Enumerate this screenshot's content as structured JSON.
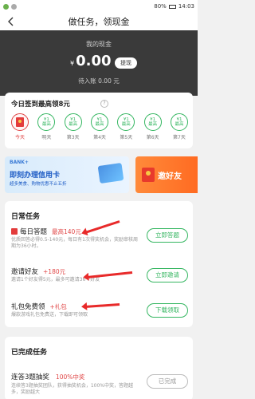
{
  "status_bar": {
    "time": "14:03",
    "battery": "80%"
  },
  "header": {
    "title": "做任务，领现金"
  },
  "money": {
    "label": "我的现金",
    "currency": "¥",
    "value": "0.00",
    "withdraw_label": "提现",
    "pending": "待入账 0.00 元"
  },
  "checkin": {
    "title": "今日签到最高领8元",
    "rules_icon": "question-icon",
    "days": [
      {
        "label": "今天",
        "amount": ""
      },
      {
        "label": "明天",
        "amount": "¥1"
      },
      {
        "label": "第3天",
        "amount": "¥1"
      },
      {
        "label": "第4天",
        "amount": "¥1"
      },
      {
        "label": "第5天",
        "amount": "¥1"
      },
      {
        "label": "第6天",
        "amount": "¥1"
      },
      {
        "label": "第7天",
        "amount": "¥1"
      }
    ],
    "coin_unit": "最高"
  },
  "banners": {
    "bank": {
      "brand": "BANK+",
      "line1": "即刻办理信用卡",
      "line2": "超多美食、购物优惠不止五折"
    },
    "invite": {
      "text": "邀好友"
    }
  },
  "daily": {
    "title": "日常任务",
    "tasks": [
      {
        "name": "每日答题",
        "reward": "最高140元",
        "desc": "优质回答必得0.5-140元，每日有1次得奖机会，奖励审核周期为36小时。",
        "button": "立即答题"
      },
      {
        "name": "邀请好友",
        "reward": "+180元",
        "desc": "邀请1个好友得5元，最多可邀请36个好友",
        "button": "立即邀请"
      },
      {
        "name": "礼包免费领",
        "reward": "+礼包",
        "desc": "爆款游戏礼包免费送，下载即可领取",
        "button": "下载领取"
      }
    ]
  },
  "completed": {
    "title": "已完成任务",
    "task": {
      "name": "连答3题抽奖",
      "reward": "100%中奖",
      "desc": "连续答3题抽奖团队，获得抽奖机会，100%中奖，答题越多，奖励越大",
      "button": "已完成"
    }
  },
  "colors": {
    "accent_green": "#34b660",
    "accent_red": "#e04646",
    "dark_block": "#3a3a3a"
  }
}
